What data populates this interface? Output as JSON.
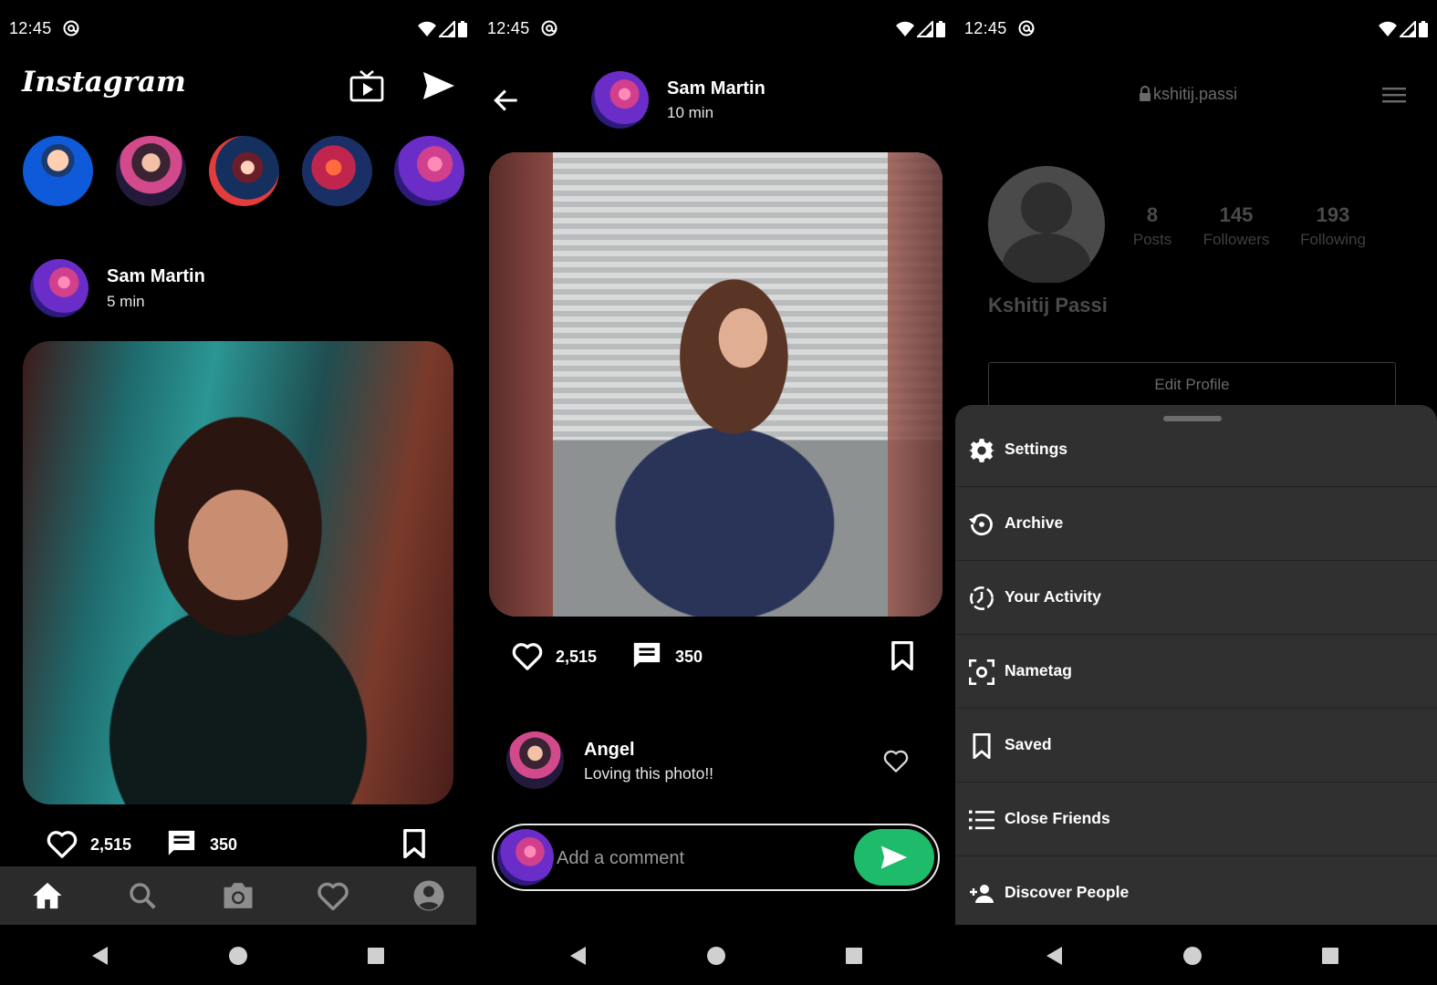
{
  "status": {
    "time": "12:45"
  },
  "feed": {
    "logo": "Instagram",
    "post": {
      "user": "Sam Martin",
      "time": "5 min",
      "likes": "2,515",
      "comments": "350"
    }
  },
  "detail": {
    "user": "Sam Martin",
    "time": "10 min",
    "likes": "2,515",
    "comments": "350",
    "comment": {
      "user": "Angel",
      "text": "Loving this photo!!"
    },
    "input_placeholder": "Add a comment"
  },
  "profile": {
    "username": "kshitij.passi",
    "name": "Kshitij Passi",
    "stats": [
      {
        "value": "8",
        "label": "Posts"
      },
      {
        "value": "145",
        "label": "Followers"
      },
      {
        "value": "193",
        "label": "Following"
      }
    ],
    "edit_label": "Edit Profile",
    "menu": [
      {
        "label": "Settings",
        "icon": "gear-icon"
      },
      {
        "label": "Archive",
        "icon": "archive-icon"
      },
      {
        "label": "Your Activity",
        "icon": "activity-icon"
      },
      {
        "label": "Nametag",
        "icon": "nametag-icon"
      },
      {
        "label": "Saved",
        "icon": "bookmark-icon"
      },
      {
        "label": "Close Friends",
        "icon": "list-icon"
      },
      {
        "label": "Discover People",
        "icon": "add-person-icon"
      }
    ]
  },
  "colors": {
    "accent": "#1dbb6a",
    "sheet": "#303030",
    "tabbar": "#2b2b2b"
  }
}
